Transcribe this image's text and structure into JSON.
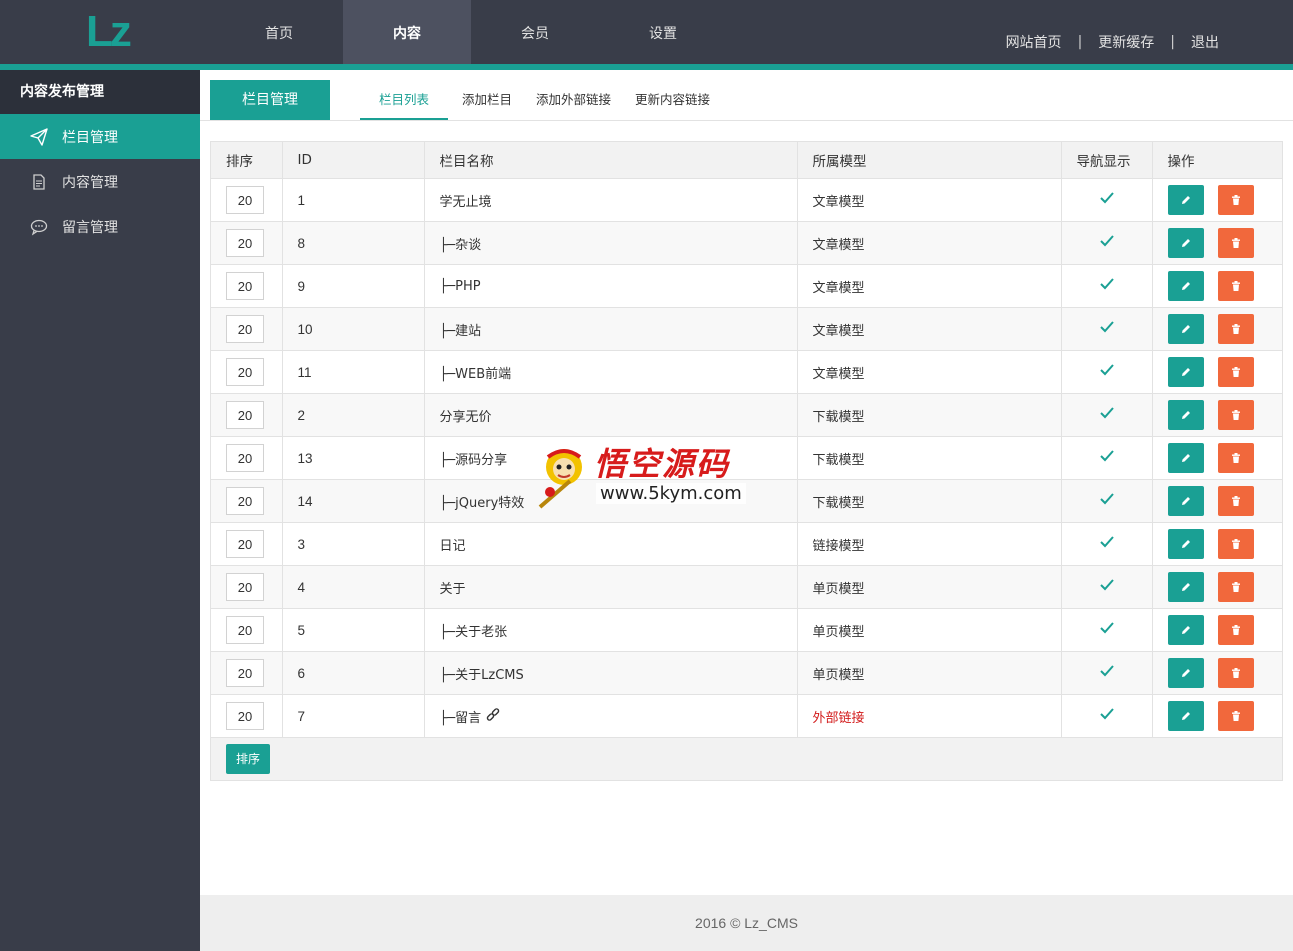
{
  "app": {
    "logo_text": "Lz"
  },
  "top_nav": [
    {
      "label": "首页",
      "active": false
    },
    {
      "label": "内容",
      "active": true
    },
    {
      "label": "会员",
      "active": false
    },
    {
      "label": "设置",
      "active": false
    }
  ],
  "top_links": {
    "home": "网站首页",
    "sep1": "|",
    "cache": "更新缓存",
    "sep2": "|",
    "logout": "退出"
  },
  "sidebar": {
    "title": "内容发布管理",
    "items": [
      {
        "label": "栏目管理",
        "icon": "paper-plane-icon",
        "active": true
      },
      {
        "label": "内容管理",
        "icon": "document-icon",
        "active": false
      },
      {
        "label": "留言管理",
        "icon": "chat-bubble-icon",
        "active": false
      }
    ]
  },
  "page": {
    "title": "栏目管理",
    "tabs": [
      {
        "label": "栏目列表",
        "active": true
      },
      {
        "label": "添加栏目",
        "active": false
      },
      {
        "label": "添加外部链接",
        "active": false
      },
      {
        "label": "更新内容链接",
        "active": false
      }
    ]
  },
  "table": {
    "headers": [
      "排序",
      "ID",
      "栏目名称",
      "所属模型",
      "导航显示",
      "操作"
    ],
    "rows": [
      {
        "sort": "20",
        "id": "1",
        "name": "学无止境",
        "model": "文章模型"
      },
      {
        "sort": "20",
        "id": "8",
        "name": "├─杂谈",
        "model": "文章模型"
      },
      {
        "sort": "20",
        "id": "9",
        "name": "├─PHP",
        "model": "文章模型"
      },
      {
        "sort": "20",
        "id": "10",
        "name": "├─建站",
        "model": "文章模型"
      },
      {
        "sort": "20",
        "id": "11",
        "name": "├─WEB前端",
        "model": "文章模型"
      },
      {
        "sort": "20",
        "id": "2",
        "name": "分享无价",
        "model": "下载模型"
      },
      {
        "sort": "20",
        "id": "13",
        "name": "├─源码分享",
        "model": "下载模型"
      },
      {
        "sort": "20",
        "id": "14",
        "name": "├─jQuery特效",
        "model": "下载模型"
      },
      {
        "sort": "20",
        "id": "3",
        "name": "日记",
        "model": "链接模型"
      },
      {
        "sort": "20",
        "id": "4",
        "name": "关于",
        "model": "单页模型"
      },
      {
        "sort": "20",
        "id": "5",
        "name": "├─关于老张",
        "model": "单页模型"
      },
      {
        "sort": "20",
        "id": "6",
        "name": "├─关于LzCMS",
        "model": "单页模型"
      },
      {
        "sort": "20",
        "id": "7",
        "name": "├─留言",
        "model": "外部链接",
        "external": true
      }
    ],
    "sort_button": "排序"
  },
  "footer": {
    "text": "2016 ©  Lz_CMS"
  },
  "watermark": {
    "title": "悟空源码",
    "url": "www.5kym.com"
  },
  "colors": {
    "accent": "#1aa094",
    "danger": "#f1683c",
    "dark": "#393d49",
    "external_link": "#d21a1a"
  }
}
